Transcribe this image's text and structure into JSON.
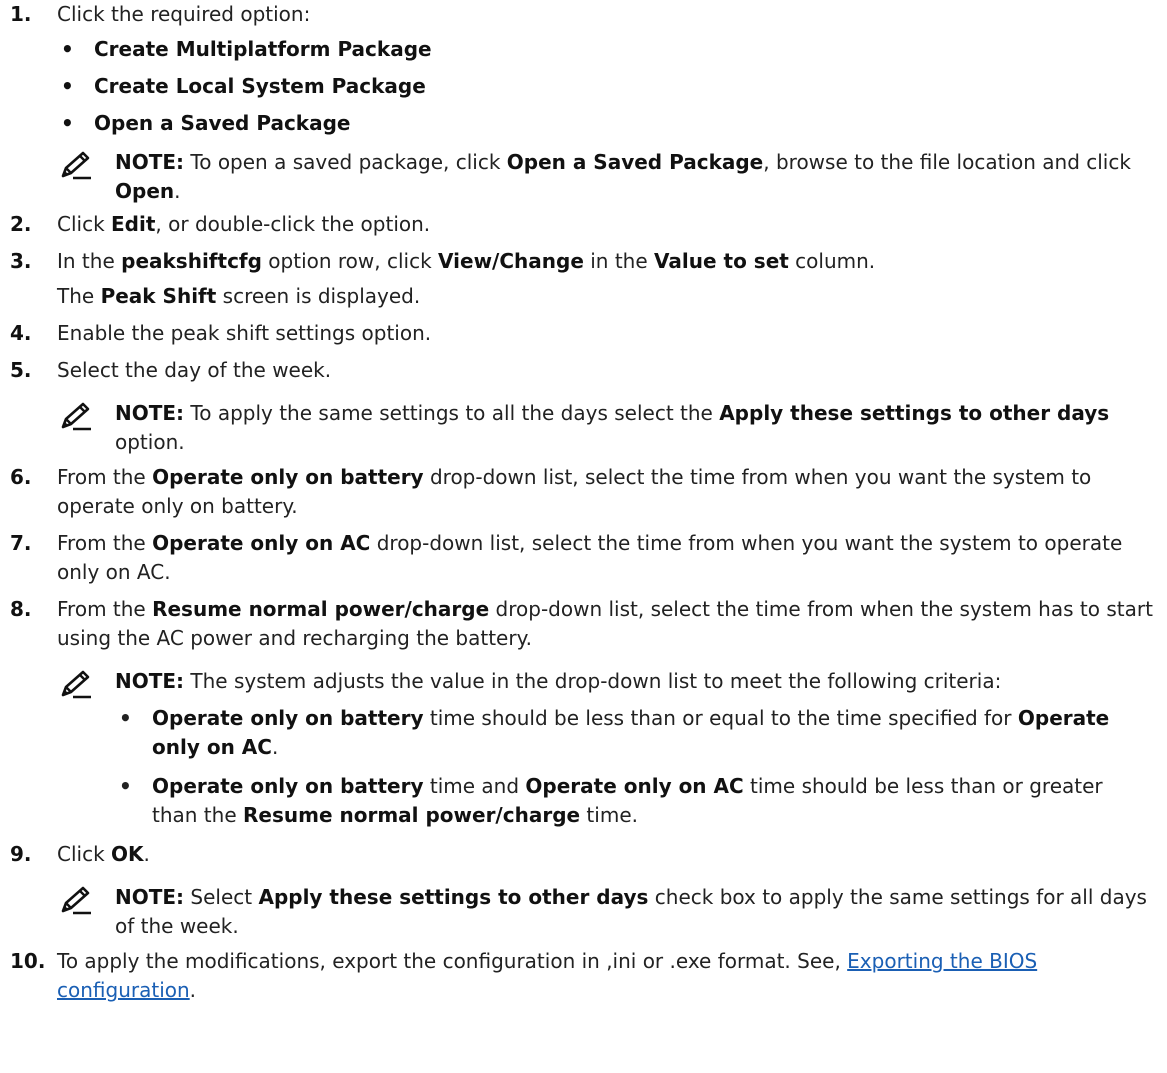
{
  "steps": [
    {
      "num": "1.",
      "text_a": "Click the required option:",
      "bullets": [
        "Create Multiplatform Package",
        "Create Local System Package",
        "Open a Saved Package"
      ],
      "note": {
        "label": "NOTE:",
        "t1": " To open a saved package, click ",
        "b1": "Open a Saved Package",
        "t2": ", browse to the file location and click ",
        "b2": "Open",
        "t3": "."
      }
    },
    {
      "num": "2.",
      "t1": "Click ",
      "b1": "Edit",
      "t2": ", or double-click the option."
    },
    {
      "num": "3.",
      "t1": "In the ",
      "b1": "peakshiftcfg",
      "t2": " option row, click ",
      "b2": "View/Change",
      "t3": " in the ",
      "b3": "Value to set",
      "t4": " column.",
      "r1": "The ",
      "rb": "Peak Shift",
      "r2": " screen is displayed."
    },
    {
      "num": "4.",
      "text": "Enable the peak shift settings option."
    },
    {
      "num": "5.",
      "text": "Select the day of the week.",
      "note": {
        "label": "NOTE:",
        "t1": " To apply the same settings to all the days select the ",
        "b1": "Apply these settings to other days",
        "t2": " option."
      }
    },
    {
      "num": "6.",
      "t1": "From the ",
      "b1": "Operate only on battery",
      "t2": " drop-down list, select the time from when you want the system to operate only on battery."
    },
    {
      "num": "7.",
      "t1": "From the ",
      "b1": "Operate only on AC",
      "t2": " drop-down list, select the time from when you want the system to operate only on AC."
    },
    {
      "num": "8.",
      "t1": "From the ",
      "b1": "Resume normal power/charge",
      "t2": " drop-down list, select the time from when the system has to start using the AC power and recharging the battery.",
      "note": {
        "label": "NOTE:",
        "t1": " The system adjusts the value in the drop-down list to meet the following criteria:"
      },
      "criteria": [
        {
          "b1": "Operate only on battery",
          "t1": " time should be less than or equal to the time specified for ",
          "b2": "Operate only on AC",
          "t2": "."
        },
        {
          "b1": "Operate only on battery",
          "t1": " time and ",
          "b2": "Operate only on AC",
          "t2": " time should be less than or greater than the ",
          "b3": "Resume normal power/charge",
          "t3": " time."
        }
      ]
    },
    {
      "num": "9.",
      "t1": "Click ",
      "b1": "OK",
      "t2": ".",
      "note": {
        "label": "NOTE:",
        "t1": " Select ",
        "b1": "Apply these settings to other days",
        "t2": " check box to apply the same settings for all days of the week."
      }
    },
    {
      "num": "10.",
      "t1": "To apply the modifications, export the configuration in ,ini or .exe format. See, ",
      "link": "Exporting the BIOS configuration",
      "t2": "."
    }
  ],
  "colors": {
    "text": "#222222",
    "link": "#1a5fb4"
  },
  "icons": {
    "note": "pencil-note-icon"
  }
}
